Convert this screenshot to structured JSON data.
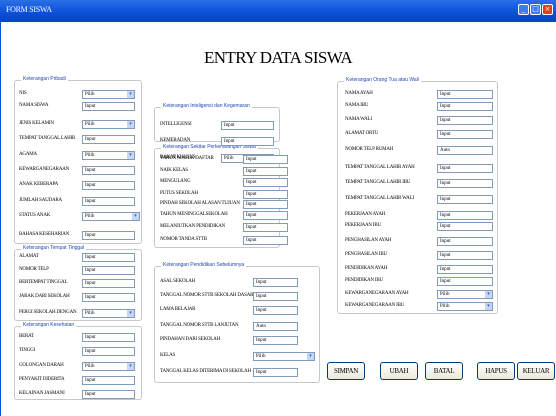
{
  "window": {
    "title": "FORM SISWA"
  },
  "heading": "ENTRY DATA SISWA",
  "panels": {
    "pribadi": "Keterangan Pribadi",
    "tinggal": "Keterangan Tempat Tinggal",
    "kesehatan": "Keterangan Kesehatan",
    "inteligensi": "Keterangan Inteligensi dan Kegemaran",
    "sekolah": "Keterangan Sekitar Perkembangan Siswa",
    "pendidikan": "Keterangan Pendidikan Sebelumnya",
    "ortu": "Keterangan Orang Tua atau Wali"
  },
  "fields": [
    {
      "label": "NIS",
      "value": "Pilih",
      "type": "combo"
    },
    {
      "label": "NAMA SISWA",
      "value": "Input",
      "type": "text"
    },
    {
      "label": "JENIS KELAMIN",
      "value": "Pilih",
      "type": "combo"
    },
    {
      "label": "TEMPAT TANGGAL LAHIR",
      "value": "Input",
      "type": "text"
    },
    {
      "label": "AGAMA",
      "value": "Pilih",
      "type": "combo"
    },
    {
      "label": "KEWARGANEGARAAN",
      "value": "Input",
      "type": "text"
    },
    {
      "label": "ANAK KEBERAPA",
      "value": "Input",
      "type": "text"
    },
    {
      "label": "JUMLAH SAUDARA",
      "value": "Input",
      "type": "text"
    },
    {
      "label": "STATUS ANAK",
      "value": "Pilih",
      "type": "combo"
    },
    {
      "label": "BAHASA KESEHARIAN",
      "value": "Input",
      "type": "text"
    },
    {
      "label": "ALAMAT",
      "value": "Input",
      "type": "text"
    },
    {
      "label": "NOMOR TELP",
      "value": "Input",
      "type": "text"
    },
    {
      "label": "BERTEMPAT TINGGAL",
      "value": "Input",
      "type": "text"
    },
    {
      "label": "JARAK DARI SEKOLAH",
      "value": "Input",
      "type": "text"
    },
    {
      "label": "PERGI SEKOLAH DENGAN",
      "value": "Pilih",
      "type": "combo"
    },
    {
      "label": "BERAT",
      "value": "Input",
      "type": "text"
    },
    {
      "label": "TINGGI",
      "value": "Input",
      "type": "text"
    },
    {
      "label": "GOLONGAN DARAH",
      "value": "Pilih",
      "type": "combo"
    },
    {
      "label": "PENYAKIT DIDERITA",
      "value": "Input",
      "type": "text"
    },
    {
      "label": "KELAINAN JASMANI",
      "value": "Input",
      "type": "text"
    },
    {
      "label": "INTELLIGENSI",
      "value": "Input",
      "type": "text"
    },
    {
      "label": "KEMERADAN",
      "value": "Input",
      "type": "text"
    },
    {
      "label": "BAKAT KHUSUS",
      "value": "Pilih",
      "type": "combo"
    },
    {
      "label": "TAHUN MASUK DAFTAR",
      "value": "Input",
      "type": "text"
    },
    {
      "label": "NAIK KELAS",
      "value": "Input",
      "type": "text"
    },
    {
      "label": "MENGULANG",
      "value": "Input",
      "type": "text"
    },
    {
      "label": "PUTUS SEKOLAH",
      "value": "Input",
      "type": "text"
    },
    {
      "label": "PINDAH SEKOLAH ALASAN TUJUAN",
      "value": "Input",
      "type": "text"
    },
    {
      "label": "TAHUN MENINGGALSEKOLAH",
      "value": "Input",
      "type": "text"
    },
    {
      "label": "MELANJUTKAN PENDIDIKAN",
      "value": "Input",
      "type": "text"
    },
    {
      "label": "NOMOR TANDA STTB",
      "value": "Input",
      "type": "text"
    },
    {
      "label": "ASAL SEKOLAH",
      "value": "Input",
      "type": "text"
    },
    {
      "label": "TANGGAL NOMOR STTB SEKOLAH DASAR",
      "value": "Input",
      "type": "text"
    },
    {
      "label": "LAMA BELAJAR",
      "value": "Input",
      "type": "text"
    },
    {
      "label": "TANGGAL NOMOR STTB LANJUTAN",
      "value": "Auto",
      "type": "text"
    },
    {
      "label": "PINDAHAN DARI SEKOLAH",
      "value": "Input",
      "type": "text"
    },
    {
      "label": "KELAS",
      "value": "Pilih",
      "type": "combo"
    },
    {
      "label": "TANGGAL KELAS DITERIMA DI SEKOLAH",
      "value": "Input",
      "type": "text"
    },
    {
      "label": "NAMA AYAH",
      "value": "Input",
      "type": "text"
    },
    {
      "label": "NAMA IBU",
      "value": "Input",
      "type": "text"
    },
    {
      "label": "NAMA WALI",
      "value": "Input",
      "type": "text"
    },
    {
      "label": "ALAMAT ORTU",
      "value": "Input",
      "type": "text"
    },
    {
      "label": "NOMOR TELP RUMAH",
      "value": "Auto",
      "type": "text"
    },
    {
      "label": "TEMPAT TANGGAL LAHIR AYAH",
      "value": "Input",
      "type": "text"
    },
    {
      "label": "TEMPAT TANGGAL LAHIR IBU",
      "value": "Input",
      "type": "text"
    },
    {
      "label": "TEMPAT TANGGAL LAHIR WALI",
      "value": "Input",
      "type": "text"
    },
    {
      "label": "PEKERJAAN AYAH",
      "value": "Input",
      "type": "text"
    },
    {
      "label": "PEKERJAAN IBU",
      "value": "Input",
      "type": "text"
    },
    {
      "label": "PENGHASILAN AYAH",
      "value": "Input",
      "type": "text"
    },
    {
      "label": "PENGHASILAN IBU",
      "value": "Input",
      "type": "text"
    },
    {
      "label": "PENDIDIKAN AYAH",
      "value": "Input",
      "type": "text"
    },
    {
      "label": "PENDIDIKAN IBU",
      "value": "Input",
      "type": "text"
    },
    {
      "label": "KEWARGANEGARAAN AYAH",
      "value": "Pilih",
      "type": "combo"
    },
    {
      "label": "KEWARGANEGARAAN IBU",
      "value": "Pilih",
      "type": "combo"
    }
  ],
  "buttons": [
    "SIMPAN",
    "UBAH",
    "BATAL",
    "HAPUS",
    "KELUAR"
  ]
}
